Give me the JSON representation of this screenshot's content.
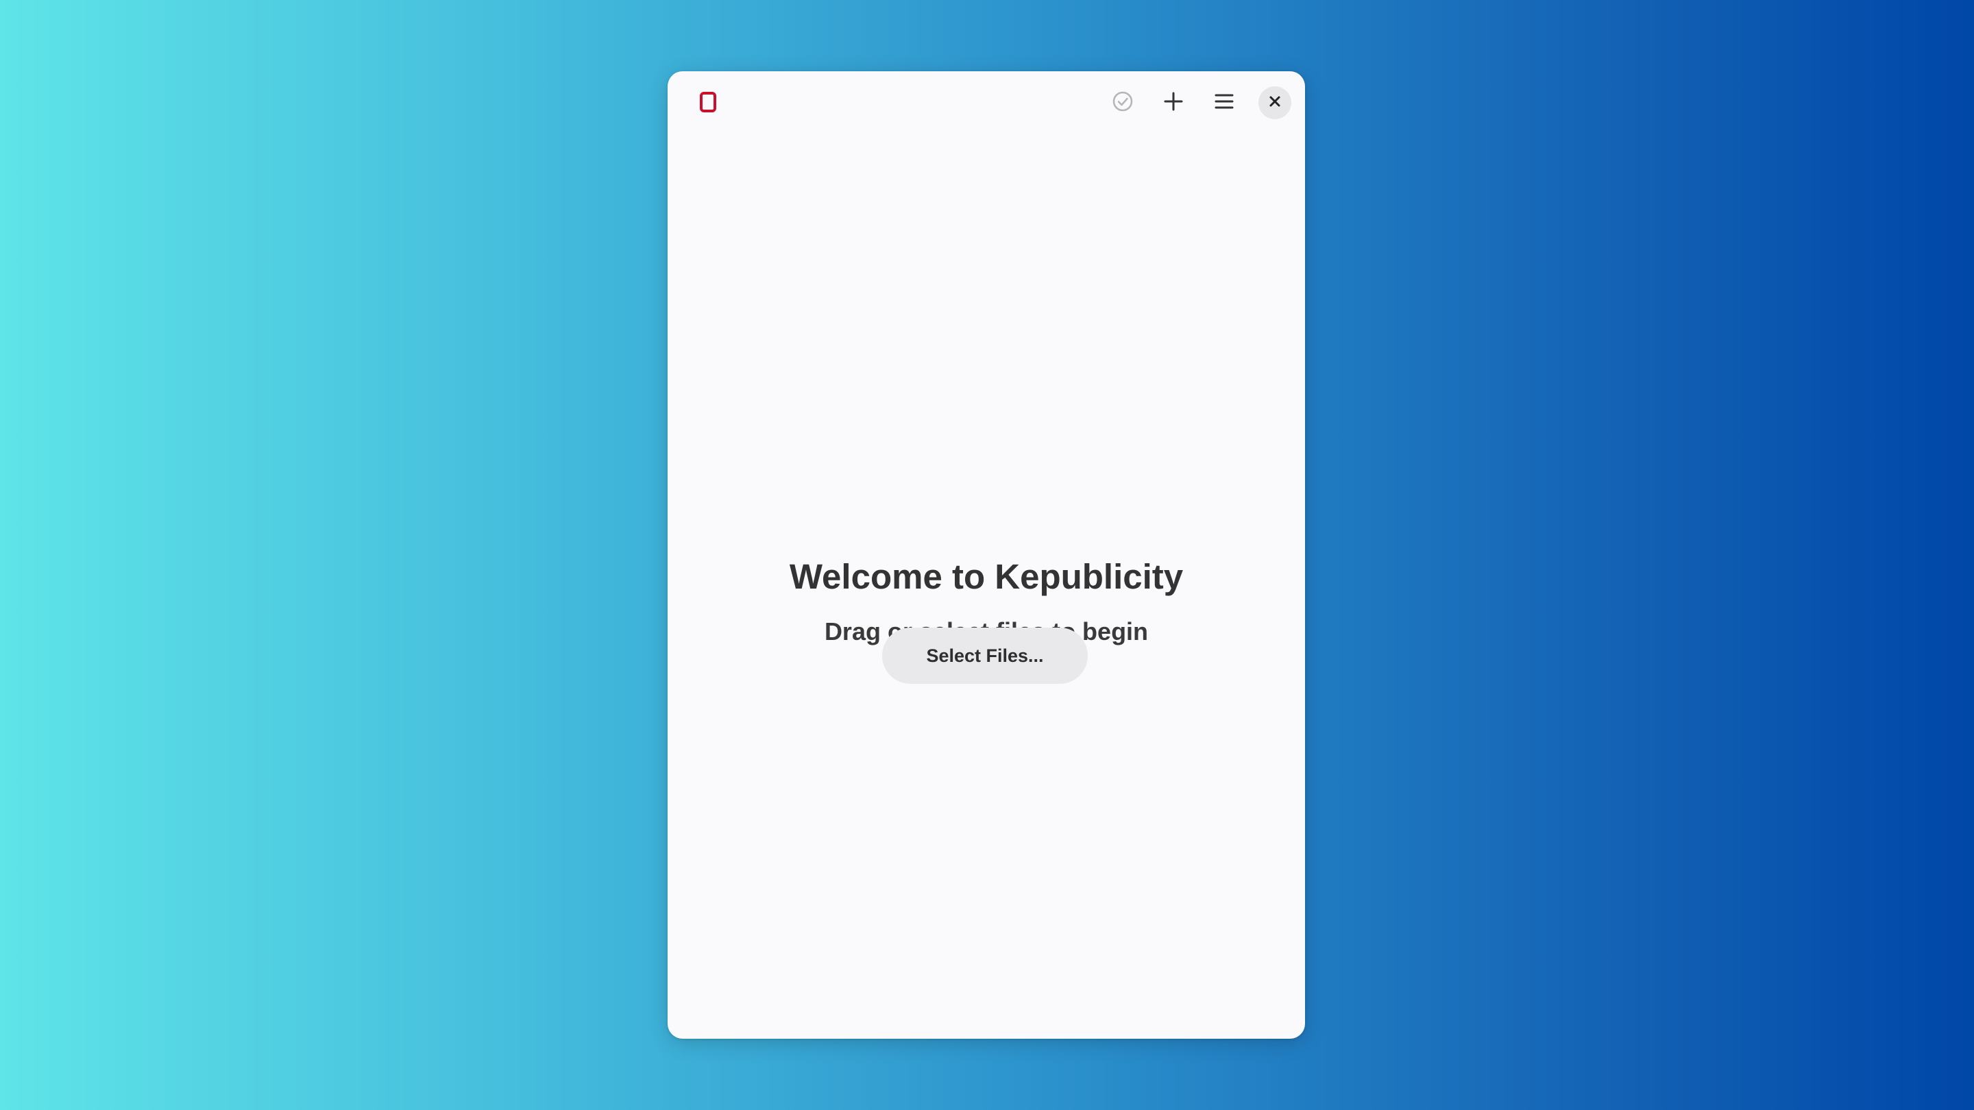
{
  "window": {
    "app_icon": "book-icon",
    "toolbar": {
      "check_icon": "check-circle-icon",
      "add_icon": "plus-icon",
      "menu_icon": "hamburger-menu-icon",
      "close_icon": "close-icon"
    }
  },
  "welcome": {
    "title": "Welcome to Kepublicity",
    "subtitle": "Drag or select files to begin",
    "select_button_label": "Select Files..."
  },
  "colors": {
    "accent_icon": "#c8102e",
    "text": "#333333",
    "button_bg": "#e9e9ec",
    "window_bg": "#fafafc"
  }
}
